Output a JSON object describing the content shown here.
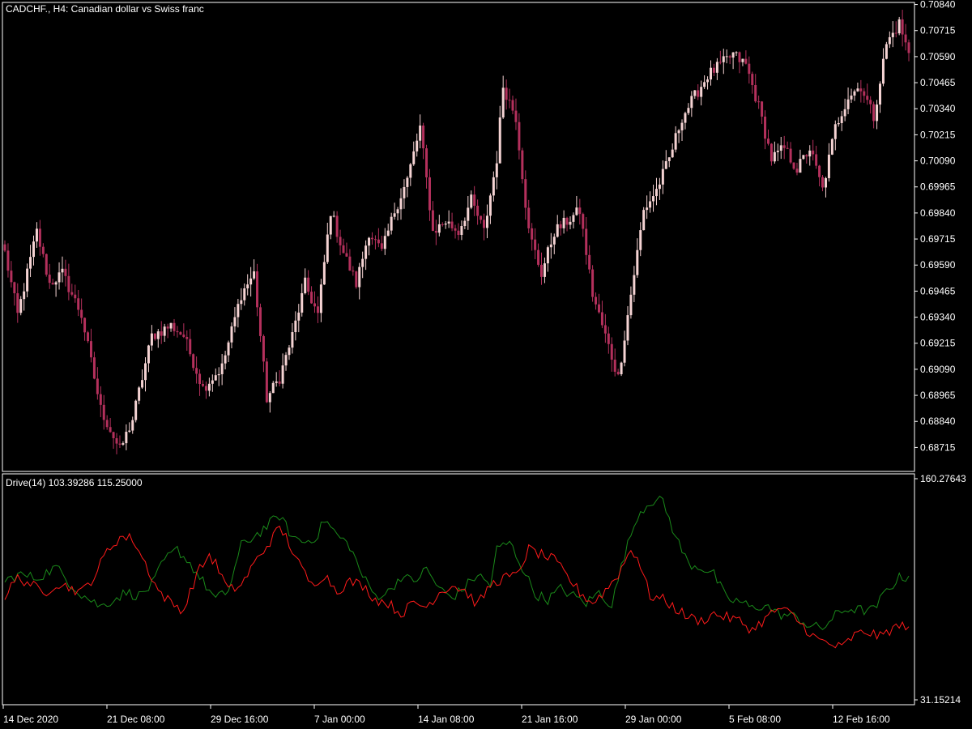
{
  "header": {
    "symbol_title": "CADCHF., H4:  Canadian dollar vs Swiss franc",
    "indicator_title": "Drive(14) 103.39286 115.25000"
  },
  "colors": {
    "background": "#000000",
    "frame": "#ffffff",
    "candle_up": "#f5d3d3",
    "candle_down": "#b4305c",
    "wick": "#c06080",
    "drive_green": "#1a8a1a",
    "drive_red": "#ff1a1a"
  },
  "chart_data": [
    {
      "type": "candlestick",
      "title": "CADCHF., H4:  Canadian dollar vs Swiss franc",
      "price_axis_ticks": [
        "0.70840",
        "0.70715",
        "0.70590",
        "0.70465",
        "0.70340",
        "0.70215",
        "0.70090",
        "0.69965",
        "0.69840",
        "0.69715",
        "0.69590",
        "0.69465",
        "0.69340",
        "0.69215",
        "0.69090",
        "0.68965",
        "0.68840",
        "0.68715"
      ],
      "ylim": [
        0.686,
        0.7085
      ],
      "time_axis_ticks": [
        "14 Dec 2020",
        "21 Dec 08:00",
        "29 Dec 16:00",
        "7 Jan 00:00",
        "14 Jan 08:00",
        "21 Jan 16:00",
        "29 Jan 00:00",
        "5 Feb 08:00",
        "12 Feb 16:00"
      ],
      "anchors": [
        [
          0,
          0.6965
        ],
        [
          4,
          0.6935
        ],
        [
          10,
          0.6975
        ],
        [
          14,
          0.695
        ],
        [
          18,
          0.6955
        ],
        [
          24,
          0.6935
        ],
        [
          30,
          0.689
        ],
        [
          36,
          0.687
        ],
        [
          40,
          0.6885
        ],
        [
          46,
          0.6925
        ],
        [
          52,
          0.693
        ],
        [
          56,
          0.6925
        ],
        [
          62,
          0.69
        ],
        [
          68,
          0.691
        ],
        [
          74,
          0.6945
        ],
        [
          78,
          0.6955
        ],
        [
          82,
          0.6895
        ],
        [
          86,
          0.6905
        ],
        [
          90,
          0.6925
        ],
        [
          94,
          0.695
        ],
        [
          98,
          0.6935
        ],
        [
          102,
          0.6985
        ],
        [
          106,
          0.6965
        ],
        [
          110,
          0.695
        ],
        [
          114,
          0.6975
        ],
        [
          118,
          0.6965
        ],
        [
          122,
          0.6985
        ],
        [
          126,
          0.7
        ],
        [
          130,
          0.7025
        ],
        [
          134,
          0.6975
        ],
        [
          138,
          0.698
        ],
        [
          142,
          0.6975
        ],
        [
          146,
          0.699
        ],
        [
          150,
          0.6975
        ],
        [
          154,
          0.701
        ],
        [
          156,
          0.7045
        ],
        [
          160,
          0.703
        ],
        [
          164,
          0.6975
        ],
        [
          168,
          0.6955
        ],
        [
          172,
          0.6975
        ],
        [
          176,
          0.698
        ],
        [
          180,
          0.6985
        ],
        [
          184,
          0.6945
        ],
        [
          188,
          0.6925
        ],
        [
          192,
          0.6905
        ],
        [
          196,
          0.6945
        ],
        [
          200,
          0.6985
        ],
        [
          204,
          0.6995
        ],
        [
          208,
          0.701
        ],
        [
          212,
          0.703
        ],
        [
          216,
          0.704
        ],
        [
          220,
          0.705
        ],
        [
          224,
          0.7055
        ],
        [
          228,
          0.706
        ],
        [
          232,
          0.7055
        ],
        [
          236,
          0.7035
        ],
        [
          240,
          0.701
        ],
        [
          244,
          0.7015
        ],
        [
          248,
          0.7005
        ],
        [
          252,
          0.7015
        ],
        [
          256,
          0.6995
        ],
        [
          260,
          0.7025
        ],
        [
          264,
          0.704
        ],
        [
          268,
          0.7045
        ],
        [
          272,
          0.703
        ],
        [
          276,
          0.7065
        ],
        [
          280,
          0.7075
        ],
        [
          283,
          0.706
        ]
      ]
    },
    {
      "type": "line",
      "title": "Drive(14) 103.39286 115.25000",
      "price_axis_ticks": [
        "160.27643",
        "31.15214"
      ],
      "ylim": [
        31.15214,
        160.27643
      ],
      "series": [
        {
          "name": "green",
          "anchors": [
            [
              0,
              100
            ],
            [
              4,
              104
            ],
            [
              10,
              102
            ],
            [
              16,
              108
            ],
            [
              20,
              100
            ],
            [
              24,
              93
            ],
            [
              30,
              86
            ],
            [
              34,
              90
            ],
            [
              38,
              94
            ],
            [
              42,
              92
            ],
            [
              46,
              98
            ],
            [
              50,
              112
            ],
            [
              54,
              118
            ],
            [
              58,
              110
            ],
            [
              62,
              100
            ],
            [
              66,
              90
            ],
            [
              70,
              95
            ],
            [
              74,
              120
            ],
            [
              80,
              128
            ],
            [
              86,
              137
            ],
            [
              90,
              125
            ],
            [
              94,
              122
            ],
            [
              98,
              126
            ],
            [
              100,
              135
            ],
            [
              104,
              126
            ],
            [
              108,
              120
            ],
            [
              112,
              103
            ],
            [
              116,
              92
            ],
            [
              120,
              94
            ],
            [
              124,
              103
            ],
            [
              128,
              100
            ],
            [
              132,
              107
            ],
            [
              136,
              96
            ],
            [
              140,
              91
            ],
            [
              144,
              97
            ],
            [
              148,
              104
            ],
            [
              152,
              98
            ],
            [
              154,
              118
            ],
            [
              158,
              122
            ],
            [
              162,
              108
            ],
            [
              166,
              93
            ],
            [
              170,
              90
            ],
            [
              174,
              96
            ],
            [
              178,
              92
            ],
            [
              182,
              88
            ],
            [
              186,
              94
            ],
            [
              190,
              87
            ],
            [
              194,
              115
            ],
            [
              198,
              137
            ],
            [
              202,
              145
            ],
            [
              206,
              145
            ],
            [
              210,
              125
            ],
            [
              214,
              110
            ],
            [
              218,
              108
            ],
            [
              222,
              104
            ],
            [
              226,
              90
            ],
            [
              230,
              89
            ],
            [
              234,
              85
            ],
            [
              238,
              87
            ],
            [
              242,
              82
            ],
            [
              248,
              80
            ],
            [
              252,
              75
            ],
            [
              256,
              74
            ],
            [
              260,
              81
            ],
            [
              264,
              85
            ],
            [
              268,
              84
            ],
            [
              272,
              84
            ],
            [
              276,
              95
            ],
            [
              280,
              102
            ],
            [
              283,
              103
            ]
          ]
        },
        {
          "name": "red",
          "anchors": [
            [
              0,
              92
            ],
            [
              4,
              102
            ],
            [
              8,
              99
            ],
            [
              12,
              93
            ],
            [
              16,
              99
            ],
            [
              20,
              97
            ],
            [
              24,
              94
            ],
            [
              28,
              103
            ],
            [
              32,
              117
            ],
            [
              36,
              125
            ],
            [
              40,
              124
            ],
            [
              44,
              110
            ],
            [
              48,
              95
            ],
            [
              52,
              88
            ],
            [
              56,
              84
            ],
            [
              60,
              104
            ],
            [
              64,
              115
            ],
            [
              66,
              110
            ],
            [
              70,
              95
            ],
            [
              74,
              98
            ],
            [
              78,
              110
            ],
            [
              82,
              120
            ],
            [
              86,
              130
            ],
            [
              88,
              125
            ],
            [
              92,
              110
            ],
            [
              96,
              98
            ],
            [
              100,
              104
            ],
            [
              104,
              95
            ],
            [
              108,
              100
            ],
            [
              112,
              98
            ],
            [
              116,
              90
            ],
            [
              120,
              88
            ],
            [
              124,
              82
            ],
            [
              128,
              88
            ],
            [
              132,
              86
            ],
            [
              136,
              94
            ],
            [
              140,
              98
            ],
            [
              144,
              95
            ],
            [
              148,
              87
            ],
            [
              152,
              98
            ],
            [
              156,
              102
            ],
            [
              160,
              103
            ],
            [
              164,
              118
            ],
            [
              168,
              115
            ],
            [
              172,
              112
            ],
            [
              176,
              103
            ],
            [
              180,
              94
            ],
            [
              184,
              88
            ],
            [
              188,
              95
            ],
            [
              192,
              104
            ],
            [
              196,
              118
            ],
            [
              198,
              114
            ],
            [
              202,
              92
            ],
            [
              206,
              90
            ],
            [
              210,
              85
            ],
            [
              214,
              80
            ],
            [
              218,
              78
            ],
            [
              222,
              82
            ],
            [
              226,
              80
            ],
            [
              230,
              78
            ],
            [
              234,
              73
            ],
            [
              238,
              79
            ],
            [
              242,
              85
            ],
            [
              246,
              82
            ],
            [
              250,
              75
            ],
            [
              254,
              68
            ],
            [
              258,
              65
            ],
            [
              262,
              63
            ],
            [
              266,
              70
            ],
            [
              270,
              72
            ],
            [
              274,
              69
            ],
            [
              278,
              74
            ],
            [
              283,
              76
            ]
          ]
        }
      ]
    }
  ]
}
